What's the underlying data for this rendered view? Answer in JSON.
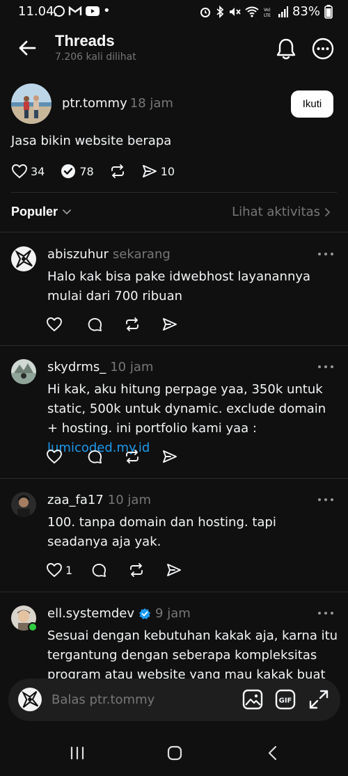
{
  "status_bar": {
    "time": "11.04",
    "battery": "83%",
    "left_icons": [
      "whatsapp-icon",
      "gmail-icon",
      "youtube-icon"
    ],
    "right_icons": [
      "alarm-icon",
      "bluetooth-icon",
      "mute-icon",
      "wifi-icon",
      "volte-icon",
      "signal-icon"
    ]
  },
  "header": {
    "title": "Threads",
    "views": "7.206 kali dilihat"
  },
  "post": {
    "username": "ptr.tommy",
    "time": "18 jam",
    "follow_label": "Ikuti",
    "text": "Jasa bikin website berapa",
    "likes": "34",
    "reposts_check": "78",
    "shares": "10"
  },
  "sort": {
    "label": "Populer",
    "activity_link": "Lihat aktivitas"
  },
  "replies": [
    {
      "username": "abiszuhur",
      "time": "sekarang",
      "text": "Halo kak bisa pake idwebhost layanannya mulai dari 700 ribuan",
      "likes": ""
    },
    {
      "username": "skydrms_",
      "time": "10 jam",
      "text": "Hi kak, aku hitung perpage yaa, 350k untuk static, 500k untuk dynamic. exclude domain + hosting. ini portfolio kami yaa : ",
      "link": "lumicoded.my.id",
      "likes": ""
    },
    {
      "username": "zaa_fa17",
      "time": "10 jam",
      "text": "100. tanpa domain dan hosting. tapi seadanya aja yak.",
      "likes": "1"
    },
    {
      "username": "ell.systemdev",
      "time": "9 jam",
      "verified": true,
      "text": "Sesuai dengan kebutuhan kakak aja, karna itu tergantung dengan seberapa kompleksitas program atau website yang mau kakak buat kak,",
      "likes": ""
    }
  ],
  "composer": {
    "placeholder": "Balas ptr.tommy"
  },
  "colors": {
    "background": "#101010",
    "text": "#f3f5f7",
    "muted": "#777777",
    "link": "#1d9bf0",
    "verified": "#1d9bf0",
    "online": "#2ecc40"
  }
}
